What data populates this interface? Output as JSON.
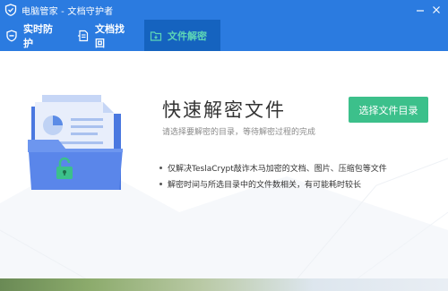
{
  "window": {
    "title": "电脑管家 - 文档守护者",
    "logo_icon": "shield-icon"
  },
  "controls": {
    "minimize_icon": "minimize-icon",
    "close_icon": "close-icon"
  },
  "tabs": [
    {
      "label": "实时防护",
      "icon": "shield-check-icon",
      "active": false
    },
    {
      "label": "文档找回",
      "icon": "document-recover-icon",
      "active": false
    },
    {
      "label": "文件解密",
      "icon": "folder-unlock-icon",
      "active": true
    }
  ],
  "main": {
    "heading": "快速解密文件",
    "subtext": "请选择要解密的目录，等待解密过程的完成",
    "select_button": "选择文件目录",
    "bullets": [
      "仅解决TeslaCrypt敲诈木马加密的文档、图片、压缩包等文件",
      "解密时间与所选目录中的文件数相关，有可能耗时较长"
    ],
    "illustration_icon": "locked-folder-illustration"
  },
  "colors": {
    "brand_blue": "#2b7be0",
    "active_tab": "#1563bf",
    "active_tab_text": "#5dd6b6",
    "button_green": "#3cc08b"
  }
}
